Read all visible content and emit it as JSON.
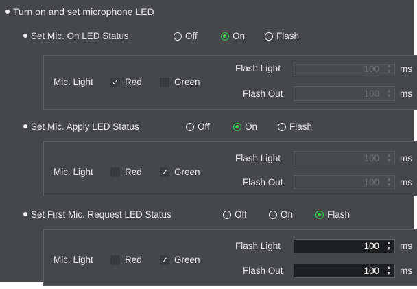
{
  "header": {
    "label": "Turn on and set microphone LED"
  },
  "sections": [
    {
      "title": "Set Mic. On LED Status",
      "options": [
        "Off",
        "On",
        "Flash"
      ],
      "selected": "On",
      "mic_light_label": "Mic. Light",
      "red_label": "Red",
      "red_checked": true,
      "green_label": "Green",
      "green_checked": false,
      "flash_light_label": "Flash Light",
      "flash_light_value": "100",
      "flash_out_label": "Flash Out",
      "flash_out_value": "100",
      "unit": "ms",
      "flash_enabled": false
    },
    {
      "title": "Set Mic. Apply LED Status",
      "options": [
        "Off",
        "On",
        "Flash"
      ],
      "selected": "On",
      "mic_light_label": "Mic. Light",
      "red_label": "Red",
      "red_checked": false,
      "green_label": "Green",
      "green_checked": true,
      "flash_light_label": "Flash Light",
      "flash_light_value": "100",
      "flash_out_label": "Flash Out",
      "flash_out_value": "100",
      "unit": "ms",
      "flash_enabled": false
    },
    {
      "title": "Set First Mic. Request LED Status",
      "options": [
        "Off",
        "On",
        "Flash"
      ],
      "selected": "Flash",
      "mic_light_label": "Mic. Light",
      "red_label": "Red",
      "red_checked": false,
      "green_label": "Green",
      "green_checked": true,
      "flash_light_label": "Flash Light",
      "flash_light_value": "100",
      "flash_out_label": "Flash Out",
      "flash_out_value": "100",
      "unit": "ms",
      "flash_enabled": true
    }
  ],
  "colors": {
    "panel_bg": "#46474a",
    "accent_green": "#2fd04a",
    "text": "#e8e8e8"
  },
  "icons": {
    "checkmark": "checkmark-icon",
    "spinner": "spinner-arrows-icon"
  }
}
